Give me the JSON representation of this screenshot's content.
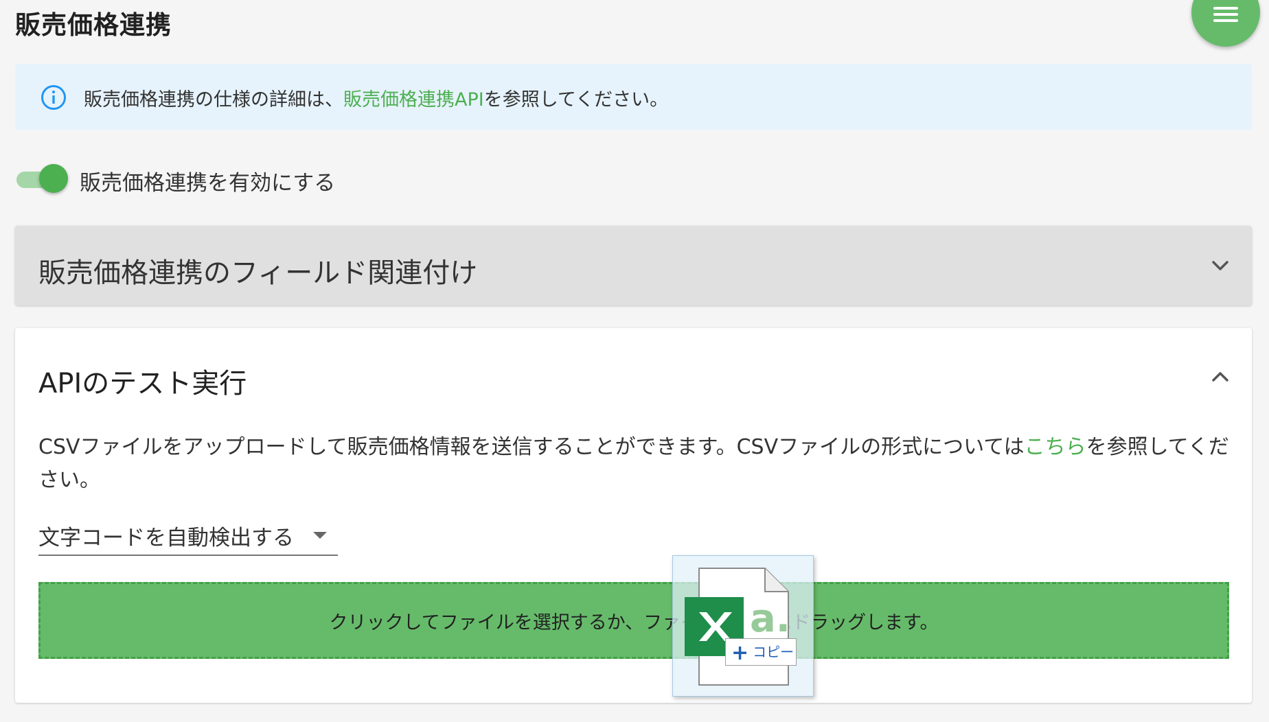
{
  "header": {
    "title": "販売価格連携"
  },
  "info": {
    "text_before": "販売価格連携の仕様の詳細は、",
    "link": "販売価格連携API",
    "text_after": "を参照してください。"
  },
  "toggle": {
    "label": "販売価格連携を有効にする",
    "enabled": true
  },
  "field_mapping_panel": {
    "title": "販売価格連携のフィールド関連付け",
    "expanded": false
  },
  "api_test_panel": {
    "title": "APIのテスト実行",
    "expanded": true,
    "description_before": "CSVファイルをアップロードして販売価格情報を送信することができます。CSVファイルの形式については",
    "description_link": "こちら",
    "description_after": "を参照してください。",
    "encoding_select": "文字コードを自動検出する",
    "dropzone_text": "クリックしてファイルを選択するか、ファイルをここにドラッグします。"
  },
  "drag_ghost": {
    "badge": "コピー",
    "icon": "excel-file-icon"
  },
  "colors": {
    "accent": "#4caf50",
    "info_bg": "#e6f3fc",
    "dropzone_bg": "#66bb6a"
  }
}
